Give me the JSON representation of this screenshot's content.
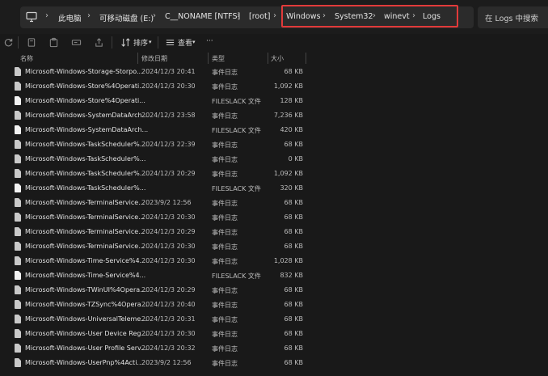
{
  "breadcrumb": {
    "items": [
      "此电脑",
      "可移动磁盘 (E:)",
      "C__NONAME [NTFS]",
      "[root]",
      "Windows",
      "System32",
      "winevt",
      "Logs"
    ]
  },
  "search": {
    "placeholder": "在 Logs 中搜索"
  },
  "toolbar": {
    "sort_label": "排序",
    "view_label": "查看"
  },
  "columns": {
    "name": "名称",
    "date": "修改日期",
    "type": "类型",
    "size": "大小"
  },
  "files": [
    {
      "name": "Microsoft-Windows-Storage-Storpo...",
      "date": "2024/12/3 20:41",
      "type": "事件日志",
      "size": "68 KB",
      "icon": "event-log"
    },
    {
      "name": "Microsoft-Windows-Store%4Operati...",
      "date": "2024/12/3 20:30",
      "type": "事件日志",
      "size": "1,092 KB",
      "icon": "event-log"
    },
    {
      "name": "Microsoft-Windows-Store%4Operati...",
      "date": "",
      "type": "FILESLACK 文件",
      "size": "128 KB",
      "icon": "file"
    },
    {
      "name": "Microsoft-Windows-SystemDataArch...",
      "date": "2024/12/3 23:58",
      "type": "事件日志",
      "size": "7,236 KB",
      "icon": "event-log"
    },
    {
      "name": "Microsoft-Windows-SystemDataArch...",
      "date": "",
      "type": "FILESLACK 文件",
      "size": "420 KB",
      "icon": "file"
    },
    {
      "name": "Microsoft-Windows-TaskScheduler%...",
      "date": "2024/12/3 22:39",
      "type": "事件日志",
      "size": "68 KB",
      "icon": "event-log"
    },
    {
      "name": "Microsoft-Windows-TaskScheduler%...",
      "date": "",
      "type": "事件日志",
      "size": "0 KB",
      "icon": "event-log"
    },
    {
      "name": "Microsoft-Windows-TaskScheduler%...",
      "date": "2024/12/3 20:29",
      "type": "事件日志",
      "size": "1,092 KB",
      "icon": "event-log"
    },
    {
      "name": "Microsoft-Windows-TaskScheduler%...",
      "date": "",
      "type": "FILESLACK 文件",
      "size": "320 KB",
      "icon": "file"
    },
    {
      "name": "Microsoft-Windows-TerminalService...",
      "date": "2023/9/2 12:56",
      "type": "事件日志",
      "size": "68 KB",
      "icon": "event-log"
    },
    {
      "name": "Microsoft-Windows-TerminalService...",
      "date": "2024/12/3 20:30",
      "type": "事件日志",
      "size": "68 KB",
      "icon": "event-log"
    },
    {
      "name": "Microsoft-Windows-TerminalService...",
      "date": "2024/12/3 20:29",
      "type": "事件日志",
      "size": "68 KB",
      "icon": "event-log"
    },
    {
      "name": "Microsoft-Windows-TerminalService...",
      "date": "2024/12/3 20:30",
      "type": "事件日志",
      "size": "68 KB",
      "icon": "event-log"
    },
    {
      "name": "Microsoft-Windows-Time-Service%4...",
      "date": "2024/12/3 20:30",
      "type": "事件日志",
      "size": "1,028 KB",
      "icon": "event-log"
    },
    {
      "name": "Microsoft-Windows-Time-Service%4...",
      "date": "",
      "type": "FILESLACK 文件",
      "size": "832 KB",
      "icon": "file"
    },
    {
      "name": "Microsoft-Windows-TWinUI%4Opera...",
      "date": "2024/12/3 20:29",
      "type": "事件日志",
      "size": "68 KB",
      "icon": "event-log"
    },
    {
      "name": "Microsoft-Windows-TZSync%4Opera...",
      "date": "2024/12/3 20:40",
      "type": "事件日志",
      "size": "68 KB",
      "icon": "event-log"
    },
    {
      "name": "Microsoft-Windows-UniversalTeleme...",
      "date": "2024/12/3 20:31",
      "type": "事件日志",
      "size": "68 KB",
      "icon": "event-log"
    },
    {
      "name": "Microsoft-Windows-User Device Reg...",
      "date": "2024/12/3 20:30",
      "type": "事件日志",
      "size": "68 KB",
      "icon": "event-log"
    },
    {
      "name": "Microsoft-Windows-User Profile Serv...",
      "date": "2024/12/3 20:32",
      "type": "事件日志",
      "size": "68 KB",
      "icon": "event-log"
    },
    {
      "name": "Microsoft-Windows-UserPnp%4Acti...",
      "date": "2023/9/2 12:56",
      "type": "事件日志",
      "size": "68 KB",
      "icon": "event-log"
    }
  ],
  "colors": {
    "background": "#191919",
    "highlight_border": "#e23a3a"
  }
}
